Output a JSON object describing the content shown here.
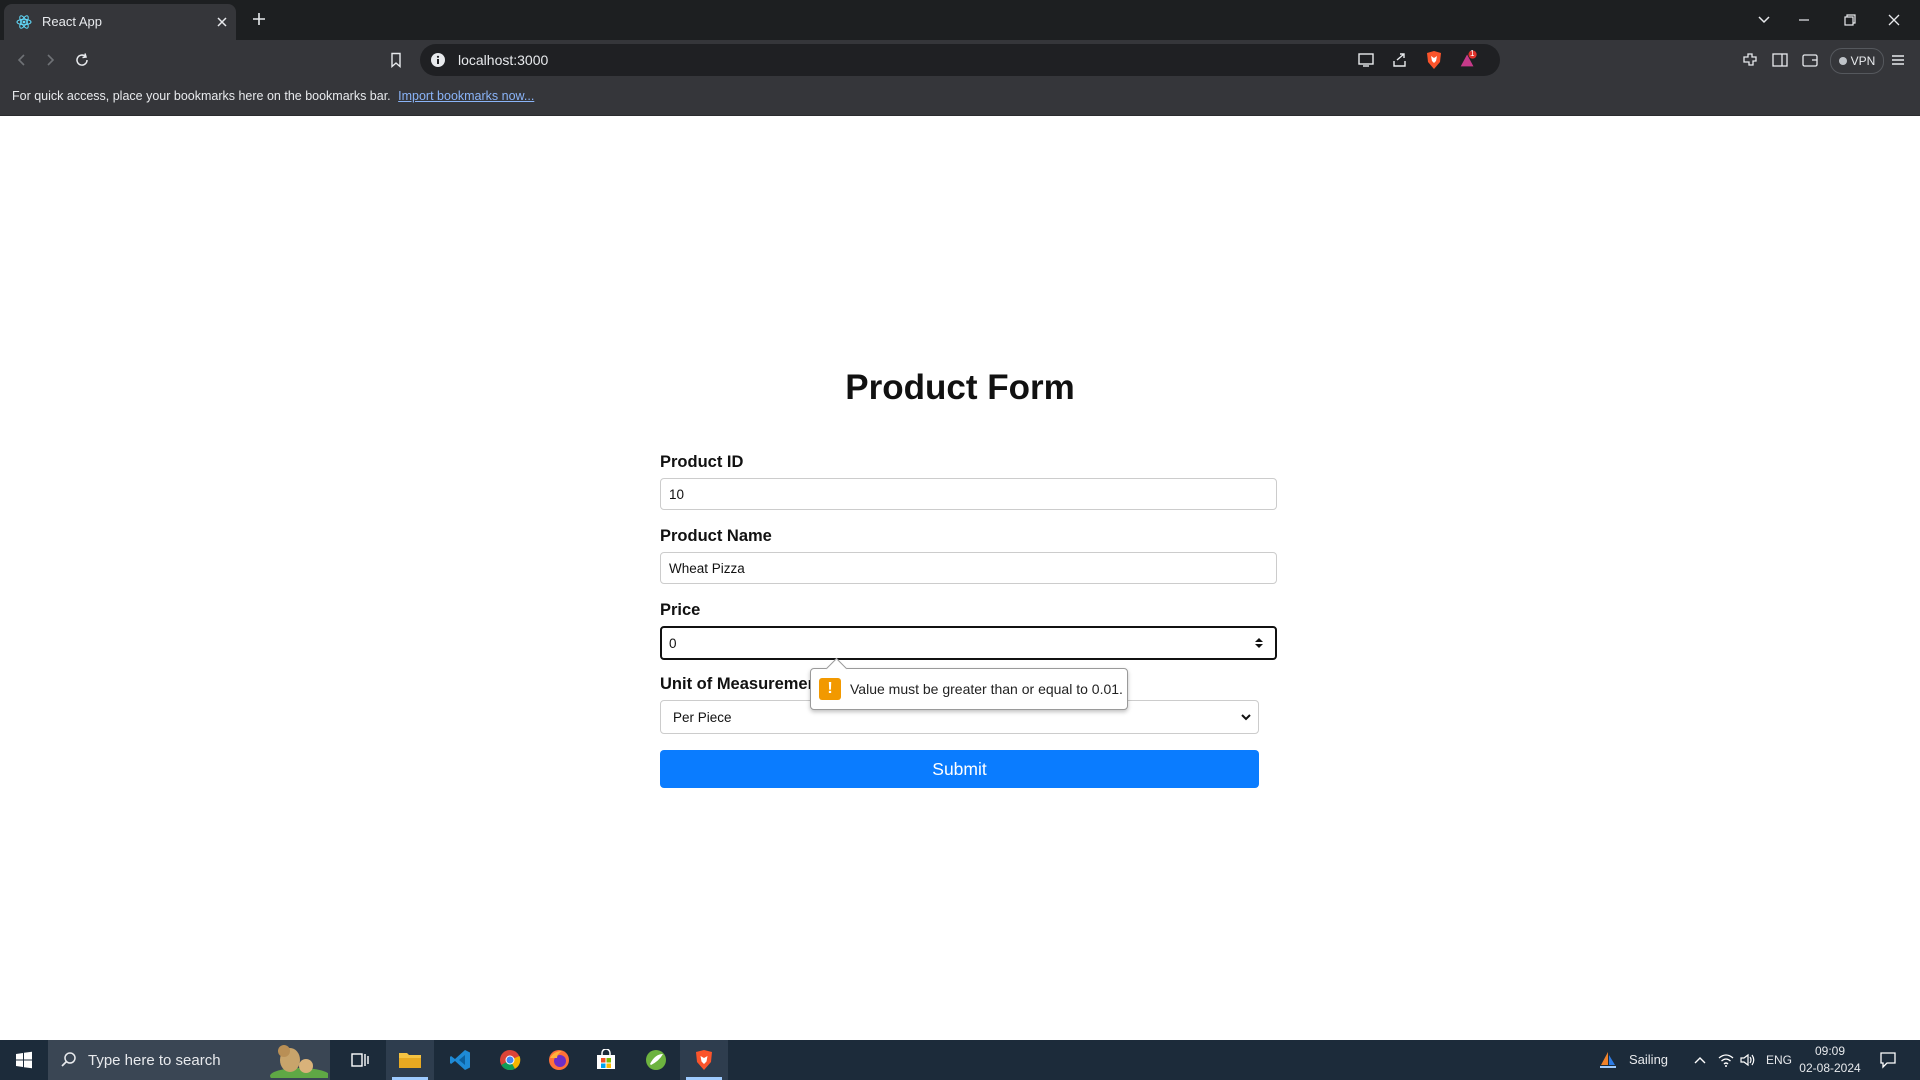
{
  "browser": {
    "tab_title": "React App",
    "url": "localhost:3000",
    "bookmarks_bar_text": "For quick access, place your bookmarks here on the bookmarks bar.",
    "bookmarks_import_link": "Import bookmarks now...",
    "vpn_label": "VPN",
    "notification_count": "1"
  },
  "form": {
    "title": "Product Form",
    "product_id_label": "Product ID",
    "product_id_value": "10",
    "product_name_label": "Product Name",
    "product_name_value": "Wheat Pizza",
    "price_label": "Price",
    "price_value": "0",
    "unit_label": "Unit of Measuremen",
    "unit_selected": "Per Piece",
    "submit_label": "Submit",
    "validation_message": "Value must be greater than or equal to 0.01."
  },
  "taskbar": {
    "search_placeholder": "Type here to search",
    "weather_label": "Sailing",
    "language": "ENG",
    "time": "09:09",
    "date": "02-08-2024"
  },
  "colors": {
    "submit_button": "#0a7cff",
    "tooltip_warning": "#f29900",
    "brave_brand": "#fb542b"
  }
}
